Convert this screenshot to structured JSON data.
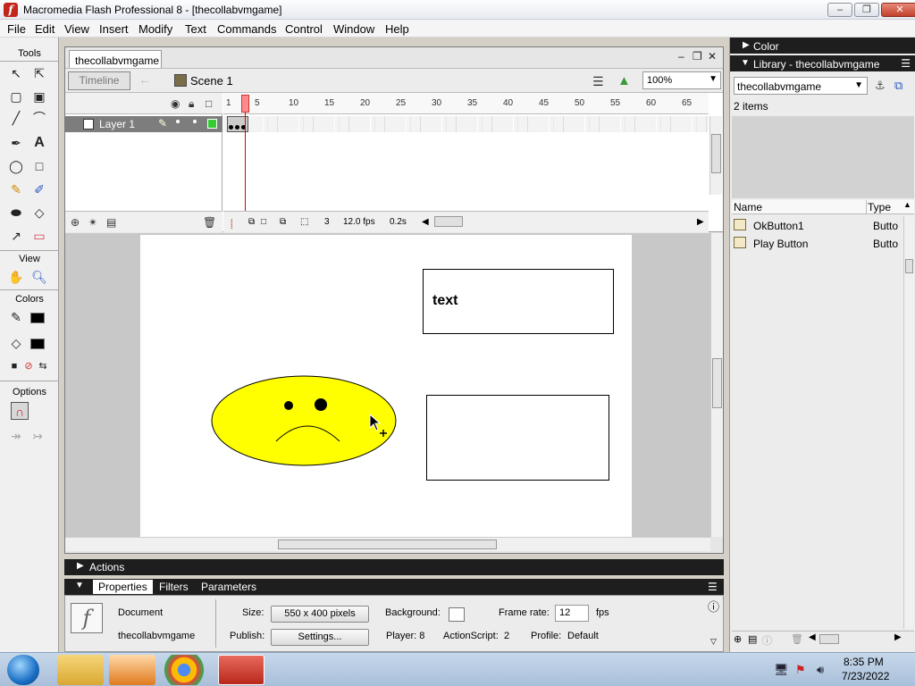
{
  "window": {
    "title": "Macromedia Flash Professional 8 - [thecollabvmgame]",
    "app_icon": "flash-icon"
  },
  "menu": [
    "File",
    "Edit",
    "View",
    "Insert",
    "Modify",
    "Text",
    "Commands",
    "Control",
    "Window",
    "Help"
  ],
  "tools": {
    "title": "Tools",
    "view_label": "View",
    "colors_label": "Colors",
    "options_label": "Options",
    "stroke_color": "#000000",
    "fill_color": "#000000"
  },
  "document": {
    "tab": "thecollabvmgame",
    "timeline_button": "Timeline",
    "scene": "Scene 1",
    "zoom": "100%"
  },
  "timeline": {
    "layer_name": "Layer 1",
    "frame_numbers": [
      "1",
      "5",
      "10",
      "15",
      "20",
      "25",
      "30",
      "35",
      "40",
      "45",
      "50",
      "55",
      "60",
      "65"
    ],
    "current_frame": "3",
    "frame_rate": "12.0 fps",
    "elapsed": "0.2s"
  },
  "stage": {
    "text_box_label": "text",
    "smiley_fill": "#ffff00"
  },
  "actions": {
    "label": "Actions"
  },
  "properties": {
    "tabs": [
      "Properties",
      "Filters",
      "Parameters"
    ],
    "doc_type": "Document",
    "doc_name": "thecollabvmgame",
    "size_label": "Size:",
    "size_value": "550 x 400 pixels",
    "publish_label": "Publish:",
    "settings_button": "Settings...",
    "background_label": "Background:",
    "frame_rate_label": "Frame rate:",
    "frame_rate_value": "12",
    "fps_label": "fps",
    "player_label": "Player: 8",
    "actionscript_label": "ActionScript:",
    "actionscript_value": "2",
    "profile_label": "Profile:",
    "profile_value": "Default"
  },
  "library": {
    "color_panel_title": "Color",
    "title": "Library - thecollabvmgame",
    "selected": "thecollabvmgame",
    "count": "2 items",
    "col_name": "Name",
    "col_type": "Type",
    "items": [
      {
        "name": "OkButton1",
        "type": "Butto"
      },
      {
        "name": "Play Button",
        "type": "Butto"
      }
    ]
  },
  "taskbar": {
    "time": "8:35 PM",
    "date": "7/23/2022"
  }
}
